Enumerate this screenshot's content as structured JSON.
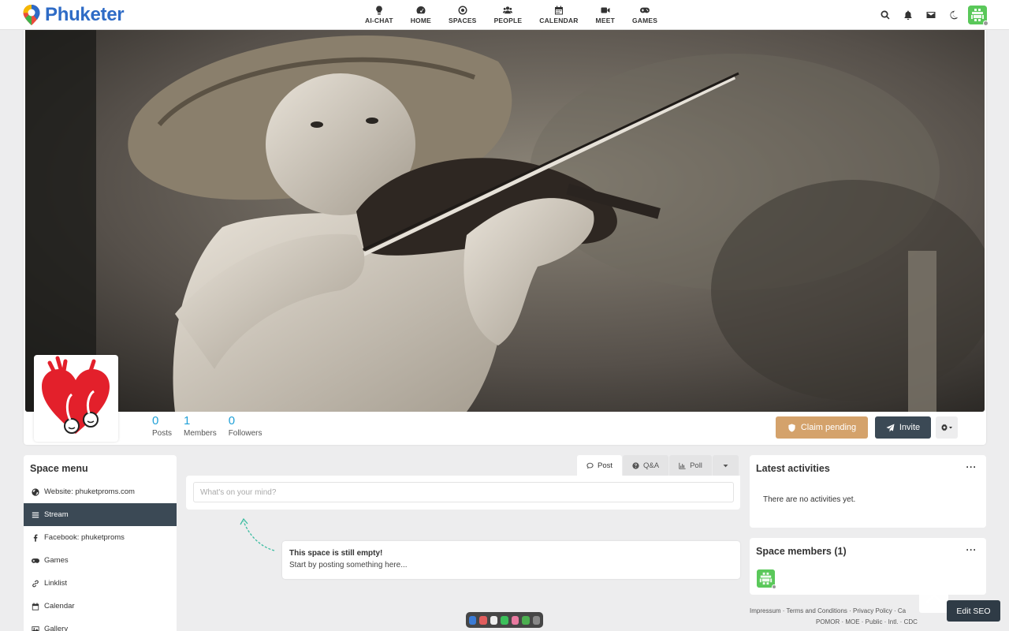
{
  "app": {
    "name": "Phuketer"
  },
  "nav": [
    {
      "label": "AI-CHAT",
      "icon": "lightbulb-icon"
    },
    {
      "label": "HOME",
      "icon": "dashboard-icon"
    },
    {
      "label": "SPACES",
      "icon": "dot-circle-icon"
    },
    {
      "label": "PEOPLE",
      "icon": "users-icon"
    },
    {
      "label": "CALENDAR",
      "icon": "calendar-icon"
    },
    {
      "label": "MEET",
      "icon": "video-icon"
    },
    {
      "label": "GAMES",
      "icon": "gamepad-icon"
    }
  ],
  "stats": {
    "posts": {
      "value": "0",
      "label": "Posts"
    },
    "members": {
      "value": "1",
      "label": "Members"
    },
    "followers": {
      "value": "0",
      "label": "Followers"
    }
  },
  "actions": {
    "claim": "Claim pending",
    "invite": "Invite"
  },
  "space_menu": {
    "title": "Space menu",
    "items": [
      {
        "label": "Website: phuketproms.com",
        "icon": "globe-icon"
      },
      {
        "label": "Stream",
        "icon": "bars-icon",
        "active": true
      },
      {
        "label": "Facebook: phuketproms",
        "icon": "facebook-icon"
      },
      {
        "label": "Games",
        "icon": "gamepad-icon"
      },
      {
        "label": "Linklist",
        "icon": "link-icon"
      },
      {
        "label": "Calendar",
        "icon": "calendar-icon"
      },
      {
        "label": "Gallery",
        "icon": "image-icon"
      }
    ]
  },
  "composer": {
    "tabs": [
      {
        "label": "Post",
        "icon": "comment-icon"
      },
      {
        "label": "Q&A",
        "icon": "question-circle-icon"
      },
      {
        "label": "Poll",
        "icon": "bar-chart-icon"
      }
    ],
    "placeholder": "What's on your mind?"
  },
  "empty_state": {
    "title": "This space is still empty!",
    "subtitle": "Start by posting something here..."
  },
  "latest": {
    "title": "Latest activities",
    "empty": "There are no activities yet.",
    "menu": "···"
  },
  "members_panel": {
    "title": "Space members (1)",
    "menu": "···"
  },
  "footer": {
    "row1": "Impressum · Terms and Conditions · Privacy Policy · Ca",
    "row2": "POMOR · MOE · Public · Intl. · CDC"
  },
  "seo_button": "Edit SEO",
  "colors": {
    "brand": "#2e6bc6",
    "accent": "#21a1d8",
    "claim": "#d4a26b",
    "dark": "#3b4955"
  }
}
